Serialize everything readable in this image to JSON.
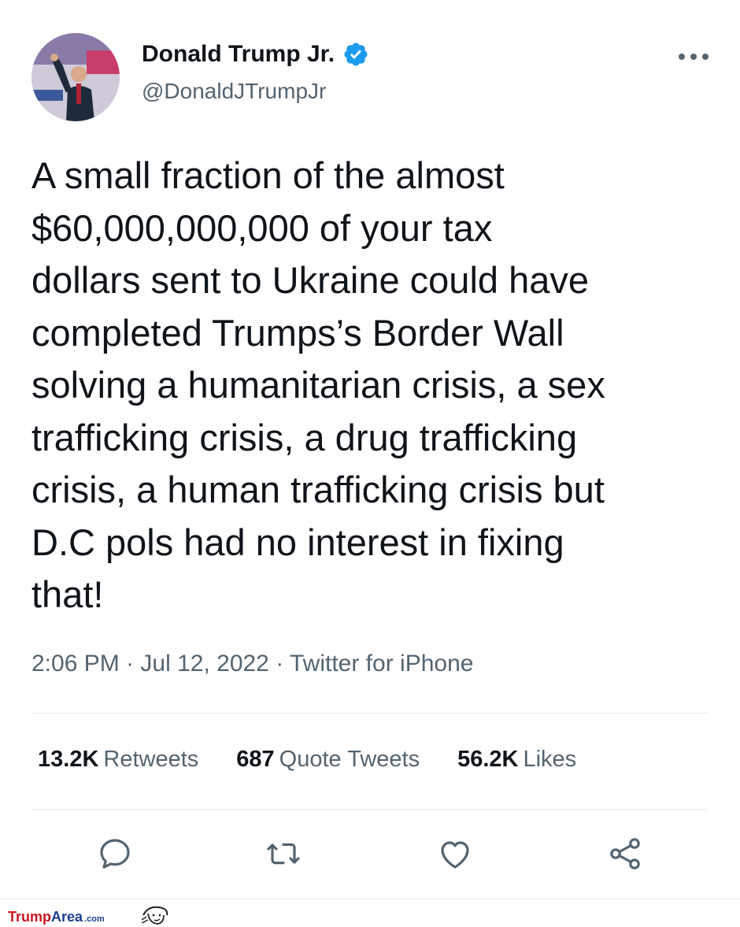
{
  "author": {
    "name": "Donald Trump Jr.",
    "handle": "@DonaldJTrumpJr",
    "verified": true
  },
  "tweet": {
    "text": "A small fraction of the almost\n$60,000,000,000 of your tax\ndollars sent to Ukraine could have\ncompleted Trumps’s Border Wall\nsolving a humanitarian crisis, a sex\ntrafficking crisis, a drug trafficking\ncrisis, a human trafficking crisis but\nD.C pols had no interest in fixing\nthat!",
    "time": "2:06 PM",
    "date": "Jul 12, 2022",
    "source": "Twitter for iPhone",
    "separator": " · "
  },
  "stats": {
    "retweets": {
      "count": "13.2K",
      "label": "Retweets"
    },
    "quotes": {
      "count": "687",
      "label": "Quote Tweets"
    },
    "likes": {
      "count": "56.2K",
      "label": "Likes"
    }
  },
  "actions": [
    "reply-icon",
    "retweet-icon",
    "like-icon",
    "share-icon"
  ],
  "footer": {
    "brand_part1": "Trump",
    "brand_part2": "Area",
    "brand_tld": ".com"
  },
  "colors": {
    "text": "#0f1419",
    "secondary": "#536471",
    "verified": "#1d9bf0",
    "brand_red": "#c8161d",
    "brand_blue": "#1b3f8f"
  }
}
